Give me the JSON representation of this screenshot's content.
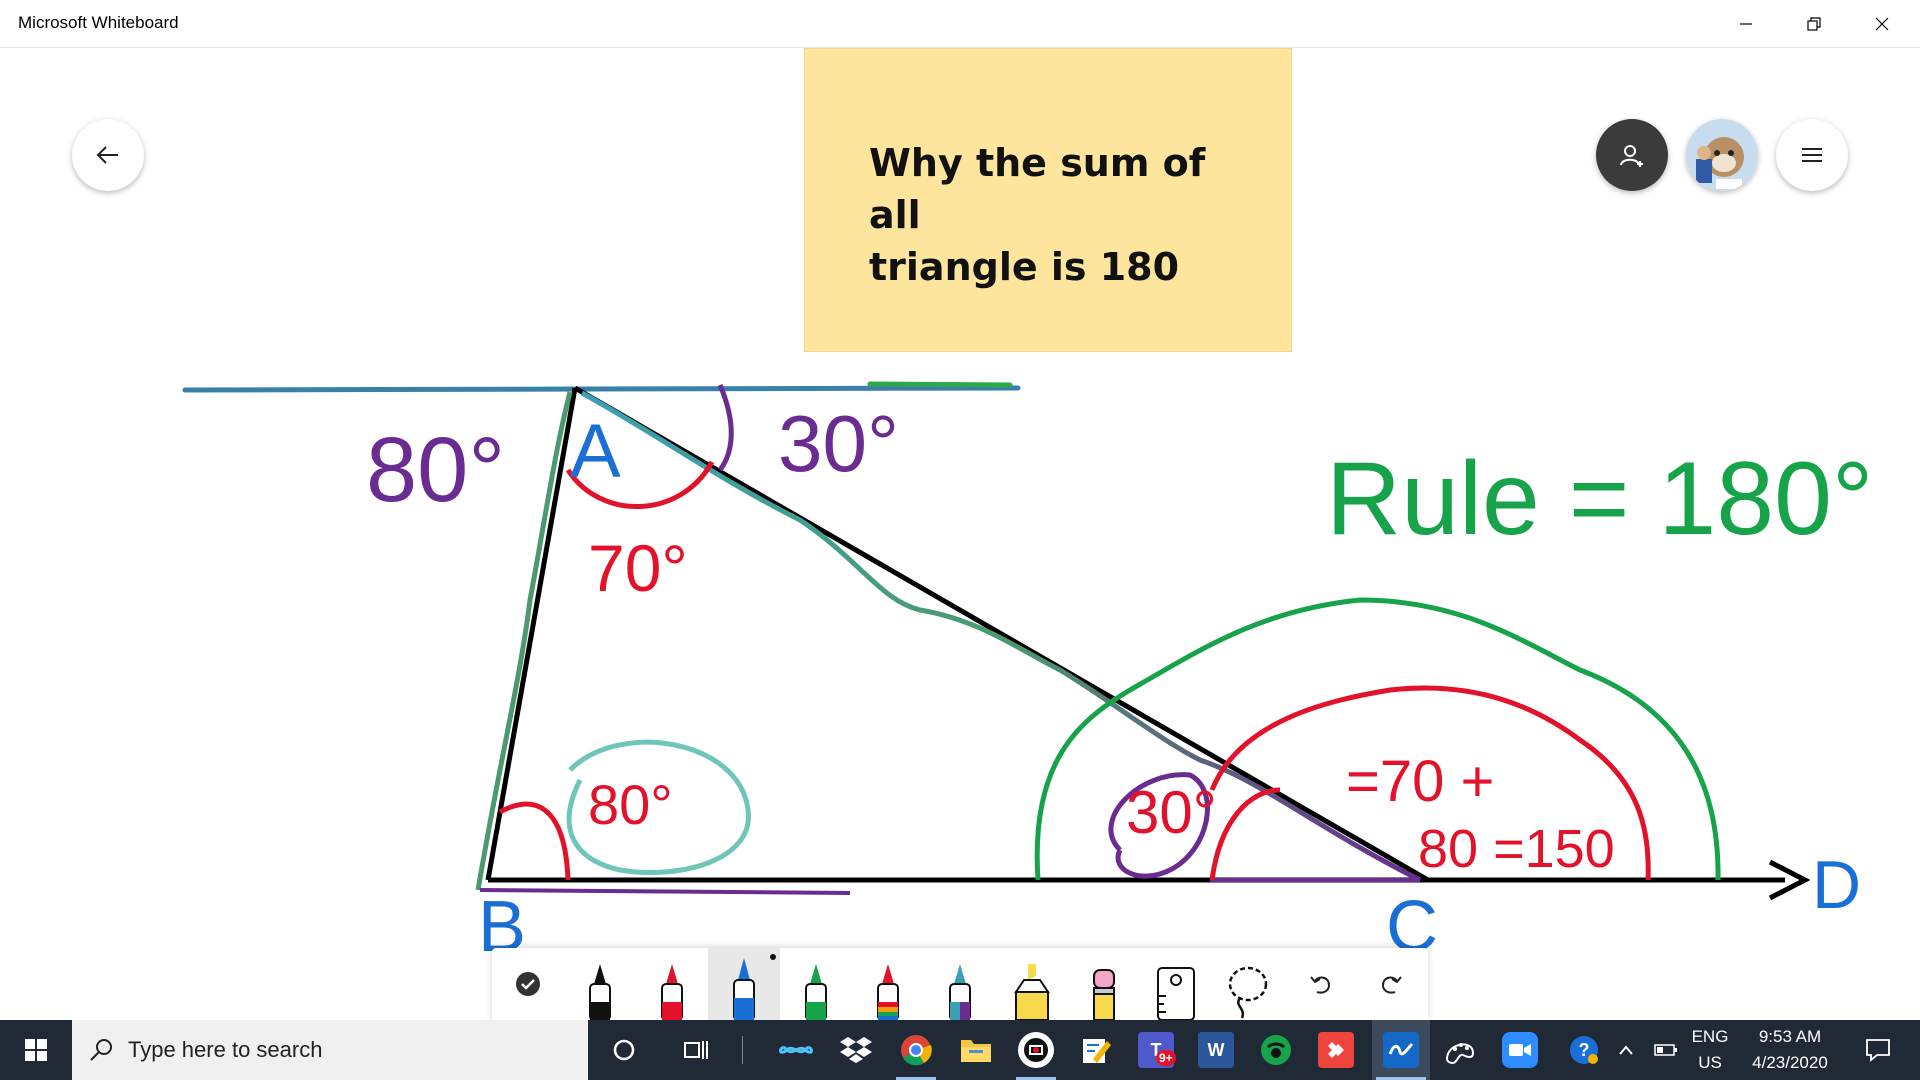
{
  "window": {
    "title": "Microsoft Whiteboard"
  },
  "sticky_note": {
    "text_line1": "Why the sum of all",
    "text_line2": "triangle is 180",
    "color": "#fde59d"
  },
  "ink_labels": {
    "vertex_a": "A",
    "vertex_b": "B",
    "vertex_c": "C",
    "vertex_d": "D",
    "angle_top_left": "80°",
    "angle_top_right": "30°",
    "angle_a": "70°",
    "angle_b": "80°",
    "angle_c": "30°",
    "sum_line1": "=70 +",
    "sum_line2": "80 =150",
    "rule": "Rule = 180°"
  },
  "ink_colors": {
    "black": "#000000",
    "red": "#e3122b",
    "blue": "#1a6fd6",
    "green": "#16a34a",
    "purple": "#6b2c91",
    "galaxy": "#3aa0b8"
  },
  "toolbar": {
    "tools": [
      "select-tool",
      "black-pen",
      "red-pen",
      "blue-pen",
      "green-pen",
      "rainbow-pen",
      "galaxy-pen",
      "highlighter",
      "eraser",
      "ruler",
      "lasso",
      "undo",
      "redo"
    ],
    "selected": "blue-pen"
  },
  "taskbar": {
    "search_placeholder": "Type here to search",
    "language_line1": "ENG",
    "language_line2": "US",
    "time": "9:53 AM",
    "date": "4/23/2020",
    "teams_badge": "9+"
  }
}
